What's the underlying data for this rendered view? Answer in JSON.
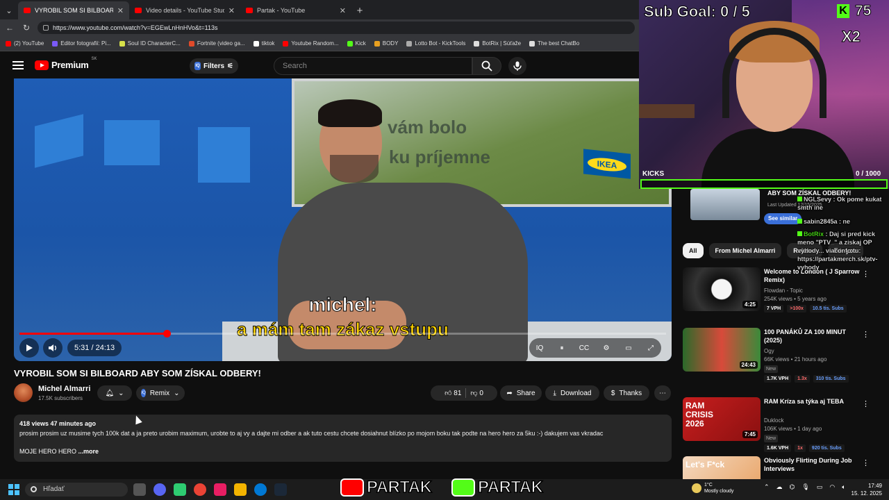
{
  "browser": {
    "tabs": [
      {
        "title": "VYROBIL SOM SI BILBOARD ABY S",
        "active": true
      },
      {
        "title": "Video details - YouTube Studio",
        "active": false
      },
      {
        "title": "Partak - YouTube",
        "active": false
      }
    ],
    "url": "https://www.youtube.com/watch?v=EGEwLnHnHVo&t=113s",
    "bookmarks": [
      {
        "label": "(2) YouTube",
        "color": "#ff0000"
      },
      {
        "label": "Editor fotografií: Pi...",
        "color": "#7a5af8"
      },
      {
        "label": "Soul ID CharacterC...",
        "color": "#d6e04a"
      },
      {
        "label": "Fortnite (video ga...",
        "color": "#e04a2a"
      },
      {
        "label": "tiktok",
        "color": "#ffffff"
      },
      {
        "label": "Youtube Random...",
        "color": "#ff0000"
      },
      {
        "label": "Kick",
        "color": "#53fc18"
      },
      {
        "label": "BODY",
        "color": "#e8a020"
      },
      {
        "label": "Lotto Bot - KickTools",
        "color": "#aaaaaa"
      },
      {
        "label": "BotRix | Súťaže",
        "color": "#dddddd"
      },
      {
        "label": "The best ChatBo",
        "color": "#dddddd"
      }
    ]
  },
  "header": {
    "logo": "Premium",
    "country": "SK",
    "filters_label": "Filters",
    "search_placeholder": "Search"
  },
  "video": {
    "billboard_line1": "vám bolo",
    "billboard_line2": "ku príjemne",
    "caption_line1": "michel:",
    "caption_line2": "a mám tam zákaz vstupu",
    "time": "5:31 / 24:13",
    "progress_fraction": 0.228,
    "title": "VYROBIL SOM SI BILBOARD ABY SOM ZÍSKAL ODBERY!"
  },
  "channel": {
    "name": "Michel Almarri",
    "subscribers": "17.5K subscribers",
    "remix_label": "Remix"
  },
  "actions": {
    "likes": "81",
    "dislikes": "0",
    "share": "Share",
    "download": "Download",
    "thanks": "Thanks"
  },
  "description": {
    "meta": "418 views  47 minutes ago",
    "body": "prosim prosim uz musime tych 100k dat a ja preto urobim maximum, urobte to aj vy a dajte mi odber a ak tuto cestu chcete dosiahnut blízko po mojom boku tak podte na hero hero za 5ku :-) dakujem vas vkradac",
    "hero": "MOJE HERO HERO",
    "more": "...more"
  },
  "overlay": {
    "sub_goal": "Sub Goal:  0 / 5",
    "kick_count": "75",
    "multiplier": "X2",
    "kicks_label": "KICKS",
    "kicks_count": "0  / 1000",
    "kicks_fraction": 0.0
  },
  "top_card": {
    "title": "ABY SOM ZÍSKAL ODBERY!",
    "updated": "Last Updated 12/15/2025",
    "see_similar": "See similar"
  },
  "chips": [
    "All",
    "From Michel Almarri",
    "Related",
    "For you"
  ],
  "recommendations": [
    {
      "title": "Welcome to London ( J Sparrow Remix)",
      "channel": "Flowdan - Topic",
      "views": "254K views • 5 years ago",
      "duration": "4:25",
      "stats": [
        "7 VPH",
        ">100x",
        "10.5 tis. Subs"
      ],
      "new": ""
    },
    {
      "title": "100 PANÁKŮ ZA 100 MINUT (2025)",
      "channel": "Ogy",
      "views": "66K views • 21 hours ago",
      "duration": "24:43",
      "stats": [
        "1.7K VPH",
        "1.3x",
        "310 tis. Subs"
      ],
      "new": "New"
    },
    {
      "title": "RAM Kríza sa týka aj TEBA",
      "channel": "Duklock",
      "views": "106K views • 1 day ago",
      "duration": "7:45",
      "stats": [
        "1.6K VPH",
        "1x",
        "920 tis. Subs"
      ],
      "new": "New",
      "thumb_text": "RAM CRISIS 2026"
    },
    {
      "title": "Obviously Flirting During Job Interviews",
      "channel": "",
      "views": "",
      "duration": "",
      "stats": [],
      "new": "",
      "thumb_text": "Let's F*ck"
    }
  ],
  "chat": [
    {
      "user": "NGLSevy",
      "text": "Ok pome kukat smth ine"
    },
    {
      "user": "sabin2845a",
      "text": "ne"
    },
    {
      "user": "BotRix",
      "text": "Daj si pred kick meno \"PTV_\" a získaj OP výhody... viac info tu: https://partakmerch.sk/ptv-vyhody"
    }
  ],
  "taskbar": {
    "search": "Hľadať",
    "banner1": "PARTAK",
    "banner2": "PARTAK",
    "weather_temp": "1°C",
    "weather_desc": "Mostly cloudy",
    "time": "17:49",
    "date": "15. 12. 2025"
  }
}
